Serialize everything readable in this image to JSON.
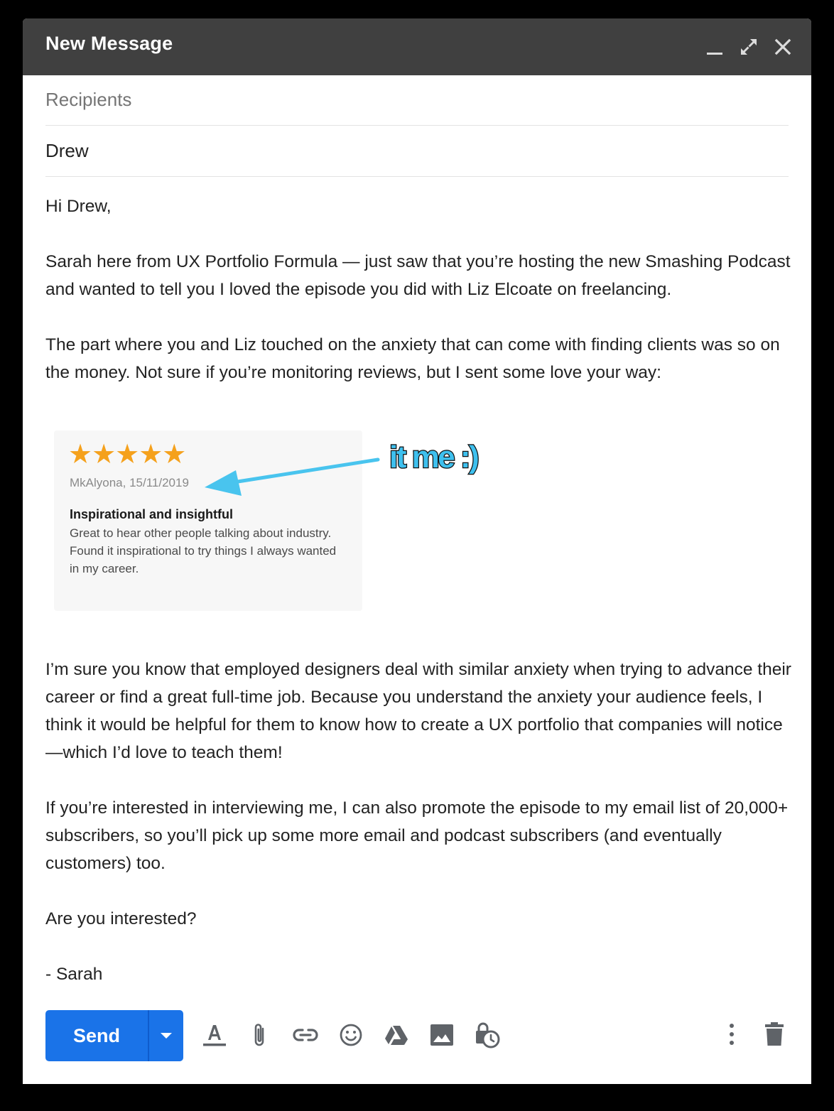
{
  "window": {
    "title": "New Message"
  },
  "fields": {
    "recipients_placeholder": "Recipients",
    "subject_value": "Drew"
  },
  "body": {
    "greeting": "Hi Drew,",
    "paragraph_1": "Sarah here from UX Portfolio Formula — just saw that you’re hosting the new Smashing Podcast and wanted to tell you I loved the episode you did with Liz Elcoate on freelancing.",
    "paragraph_2": "The part where you and Liz touched on the anxiety that can come with finding clients was so on the money. Not sure if you’re monitoring reviews, but I sent some love your way:",
    "paragraph_3": "I’m sure you know that employed designers deal with similar anxiety when trying to advance their career or find a great full-time job. Because you understand the anxiety your audience feels, I think it would be helpful for them to know how to create a UX portfolio that companies will notice—which I’d love to teach them!",
    "paragraph_4": "If you’re interested in interviewing me, I can also promote the episode to my email list of 20,000+ subscribers, so you’ll pick up some more email and podcast subscribers (and eventually customers) too.",
    "question": "Are you interested?",
    "signature": "- Sarah"
  },
  "review": {
    "stars": "★★★★★",
    "rating": 5,
    "rating_max": 5,
    "author_date": "MkAlyona, 15/11/2019",
    "title": "Inspirational and insightful",
    "text": "Great to hear other people talking about industry. Found it inspirational to try things I always wanted in my career.",
    "annotation": "it me :)"
  },
  "toolbar": {
    "send_label": "Send",
    "icons": [
      "format-text-icon",
      "attach-file-icon",
      "insert-link-icon",
      "insert-emoji-icon",
      "google-drive-icon",
      "insert-photo-icon",
      "confidential-mode-icon",
      "more-options-icon",
      "discard-draft-icon"
    ]
  },
  "colors": {
    "titlebar": "#404040",
    "send_button": "#1a73e8",
    "star": "#f5a11c",
    "annotation": "#3ec0ee",
    "icon": "#5f6368"
  }
}
